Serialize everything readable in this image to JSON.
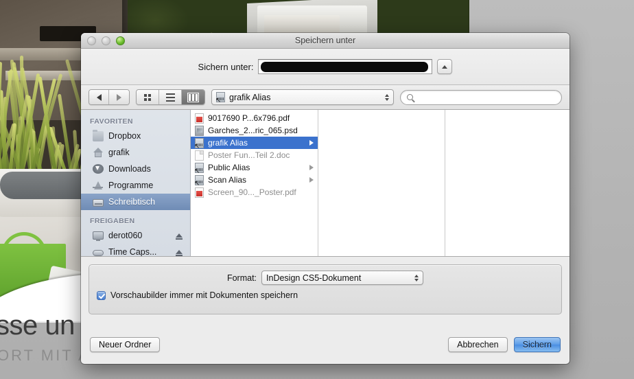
{
  "background": {
    "headline": "sse un",
    "subline": "ORT MIT AUTOMATISCHEM SONNENSCHUTZ"
  },
  "dialog": {
    "title": "Speichern unter",
    "window_controls": {
      "close": "close-button",
      "minimize": "minimize-button",
      "zoom": "zoom-button"
    },
    "name_row": {
      "label": "Sichern unter:",
      "value": "",
      "redacted": true,
      "expand_button": "expand-toggle"
    },
    "toolbar": {
      "back": "back",
      "forward": "forward",
      "view_modes": [
        {
          "name": "icon-view",
          "selected": false
        },
        {
          "name": "list-view",
          "selected": false
        },
        {
          "name": "column-view",
          "selected": true
        }
      ],
      "path_popup": "grafik Alias",
      "search_placeholder": ""
    },
    "sidebar": {
      "sections": [
        {
          "header": "FAVORITEN",
          "items": [
            {
              "label": "Dropbox",
              "icon": "folder-icon",
              "active": false,
              "eject": false
            },
            {
              "label": "grafik",
              "icon": "home-icon",
              "active": false,
              "eject": false
            },
            {
              "label": "Downloads",
              "icon": "downloads-icon",
              "active": false,
              "eject": false
            },
            {
              "label": "Programme",
              "icon": "applications-icon",
              "active": false,
              "eject": false
            },
            {
              "label": "Schreibtisch",
              "icon": "desktop-icon",
              "active": true,
              "eject": false
            }
          ]
        },
        {
          "header": "FREIGABEN",
          "items": [
            {
              "label": "derot060",
              "icon": "monitor-icon",
              "active": false,
              "eject": true
            },
            {
              "label": "Time Caps...",
              "icon": "timecapsule-icon",
              "active": false,
              "eject": true
            }
          ]
        }
      ]
    },
    "file_list": [
      {
        "label": "9017690 P...6x796.pdf",
        "icon": "pdf-icon",
        "selected": false,
        "dim": false,
        "disclosure": false
      },
      {
        "label": "Garches_2...ric_065.psd",
        "icon": "psd-icon",
        "selected": false,
        "dim": false,
        "disclosure": false
      },
      {
        "label": "grafik Alias",
        "icon": "alias-icon",
        "selected": true,
        "dim": false,
        "disclosure": true
      },
      {
        "label": "Poster Fun...Teil 2.doc",
        "icon": "doc-icon",
        "selected": false,
        "dim": true,
        "disclosure": false
      },
      {
        "label": "Public Alias",
        "icon": "alias-icon",
        "selected": false,
        "dim": false,
        "disclosure": true
      },
      {
        "label": "Scan Alias",
        "icon": "alias-icon",
        "selected": false,
        "dim": false,
        "disclosure": true
      },
      {
        "label": "Screen_90..._Poster.pdf",
        "icon": "pdf-icon",
        "selected": false,
        "dim": true,
        "disclosure": false
      }
    ],
    "options": {
      "format_label": "Format:",
      "format_value": "InDesign CS5-Dokument",
      "preview_checkbox_label": "Vorschaubilder immer mit Dokumenten speichern",
      "preview_checked": true
    },
    "footer": {
      "new_folder": "Neuer Ordner",
      "cancel": "Abbrechen",
      "save": "Sichern"
    },
    "colors": {
      "selection_blue": "#3b72cd",
      "sidebar_selection": "#7a95bd",
      "default_button_blue": "#5d9de8",
      "checkbox_blue": "#4a7fd0"
    }
  }
}
